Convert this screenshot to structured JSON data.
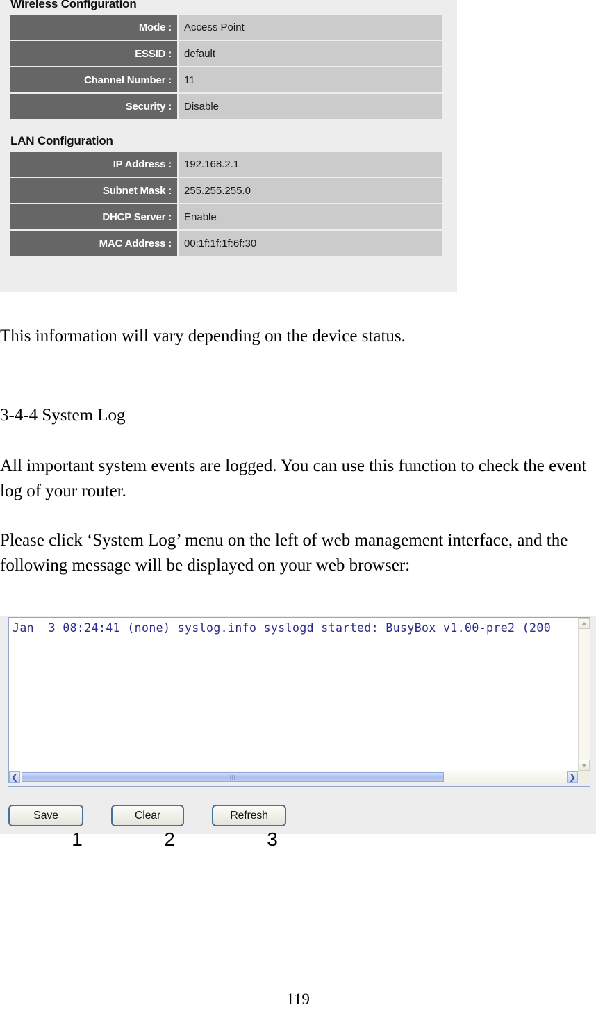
{
  "status_screenshot": {
    "wireless": {
      "heading": "Wireless Configuration",
      "rows": [
        {
          "label": "Mode :",
          "value": "Access Point"
        },
        {
          "label": "ESSID :",
          "value": "default"
        },
        {
          "label": "Channel Number :",
          "value": "11"
        },
        {
          "label": "Security :",
          "value": "Disable"
        }
      ]
    },
    "lan": {
      "heading": "LAN Configuration",
      "rows": [
        {
          "label": "IP Address :",
          "value": "192.168.2.1"
        },
        {
          "label": "Subnet Mask :",
          "value": "255.255.255.0"
        },
        {
          "label": "DHCP Server :",
          "value": "Enable"
        },
        {
          "label": "MAC Address :",
          "value": "00:1f:1f:1f:6f:30"
        }
      ]
    }
  },
  "document": {
    "para_vary": "This information will vary depending on the device status.",
    "heading_344": "3-4-4 System Log",
    "para_logged": "All important system events are logged. You can use this function to check the event log of your router.",
    "para_click": "Please click ‘System Log’ menu on the left of web management interface, and the following message will be displayed on your web browser:",
    "page_number": "119"
  },
  "log_screenshot": {
    "log_text": "Jan  3 08:24:41 (none) syslog.info syslogd started: BusyBox v1.00-pre2 (200",
    "scroll": {
      "up_arrow": "▲",
      "down_arrow": "▼",
      "left_arrow": "❮",
      "right_arrow": "❯"
    },
    "buttons": {
      "save": "Save",
      "clear": "Clear",
      "refresh": "Refresh"
    }
  },
  "callouts": {
    "one": "1",
    "two": "2",
    "three": "3"
  },
  "colors": {
    "label_cell": "#666666",
    "value_cell": "#cbcbcb",
    "panel_bg": "#ededed",
    "log_text": "#2a2a8c",
    "button_border": "#4a6f99"
  }
}
